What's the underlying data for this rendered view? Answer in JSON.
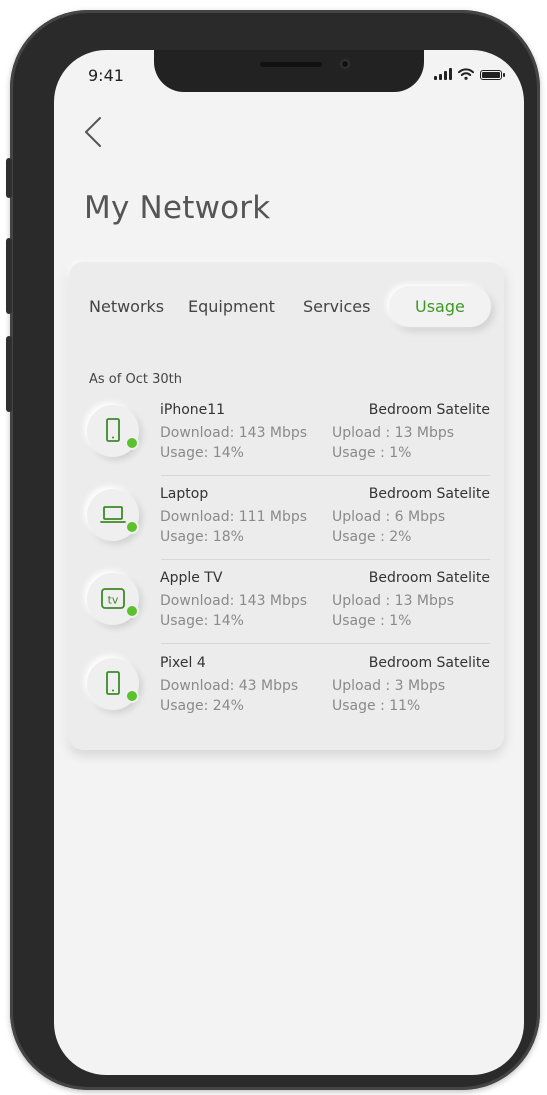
{
  "status_bar": {
    "time": "9:41"
  },
  "header": {
    "title": "My Network"
  },
  "tabs": [
    {
      "label": "Networks",
      "active": false
    },
    {
      "label": "Equipment",
      "active": false
    },
    {
      "label": "Services",
      "active": false
    },
    {
      "label": "Usage",
      "active": true
    }
  ],
  "usage": {
    "as_of": "As of Oct 30th",
    "devices": [
      {
        "name": "iPhone11",
        "icon": "phone-icon",
        "satellite": "Bedroom Satelite",
        "download": "Download: 143 Mbps",
        "usage": "Usage: 14%",
        "upload": "Upload : 13 Mbps",
        "upload_usage": "Usage : 1%"
      },
      {
        "name": "Laptop",
        "icon": "laptop-icon",
        "satellite": "Bedroom Satelite",
        "download": "Download: 111 Mbps",
        "usage": "Usage: 18%",
        "upload": "Upload : 6 Mbps",
        "upload_usage": "Usage : 2%"
      },
      {
        "name": "Apple TV",
        "icon": "tv-icon",
        "icon_text": "tv",
        "satellite": "Bedroom Satelite",
        "download": "Download: 143 Mbps",
        "usage": "Usage: 14%",
        "upload": "Upload : 13 Mbps",
        "upload_usage": "Usage : 1%"
      },
      {
        "name": "Pixel 4",
        "icon": "phone-icon",
        "satellite": "Bedroom Satelite",
        "download": "Download: 43 Mbps",
        "usage": "Usage: 24%",
        "upload": "Upload : 3 Mbps",
        "upload_usage": "Usage : 11%"
      }
    ]
  },
  "colors": {
    "accent": "#3d9a25",
    "online_dot": "#5cc12e",
    "icon_stroke": "#3d8a2a"
  }
}
